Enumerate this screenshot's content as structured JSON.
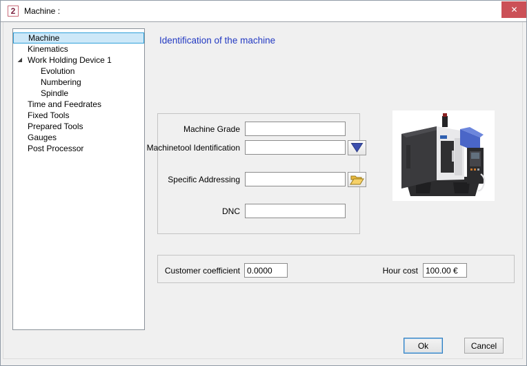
{
  "window": {
    "title": "Machine :",
    "app_icon_glyph": "2",
    "close_glyph": "✕"
  },
  "sidebar": {
    "items": [
      {
        "label": "Machine",
        "level": 0,
        "selected": true
      },
      {
        "label": "Kinematics",
        "level": 0
      },
      {
        "label": "Work Holding Device 1",
        "level": 0,
        "expanded": true
      },
      {
        "label": "Evolution",
        "level": 1
      },
      {
        "label": "Numbering",
        "level": 1
      },
      {
        "label": "Spindle",
        "level": 1
      },
      {
        "label": "Time and Feedrates",
        "level": 0
      },
      {
        "label": "Fixed Tools",
        "level": 0
      },
      {
        "label": "Prepared Tools",
        "level": 0
      },
      {
        "label": "Gauges",
        "level": 0
      },
      {
        "label": "Post Processor",
        "level": 0
      }
    ]
  },
  "main": {
    "heading": "Identification of the machine",
    "identification": {
      "machine_grade_label": "Machine Grade",
      "machine_grade_value": "",
      "machinetool_identification_label": "Machinetool Identification",
      "machinetool_identification_value": "",
      "specific_addressing_label": "Specific Addressing",
      "specific_addressing_value": "",
      "dnc_label": "DNC",
      "dnc_value": ""
    },
    "costs": {
      "customer_coefficient_label": "Customer coefficient",
      "customer_coefficient_value": "0.0000",
      "hour_cost_label": "Hour cost",
      "hour_cost_value": "100.00 €"
    },
    "photo_alt": "CNC machining center"
  },
  "footer": {
    "ok_label": "Ok",
    "cancel_label": "Cancel"
  },
  "icons": {
    "dropdown": "blue-down-triangle",
    "browse": "open-folder",
    "expander": "expanded-triangle"
  },
  "colors": {
    "heading_blue": "#2239c2",
    "close_red": "#cb5057",
    "selection_fill": "#cde8f8",
    "selection_border": "#2ea0da",
    "dropdown_triangle": "#3c4fae",
    "folder_yellow": "#f6c94a",
    "client_bg": "#f0f0f0"
  }
}
